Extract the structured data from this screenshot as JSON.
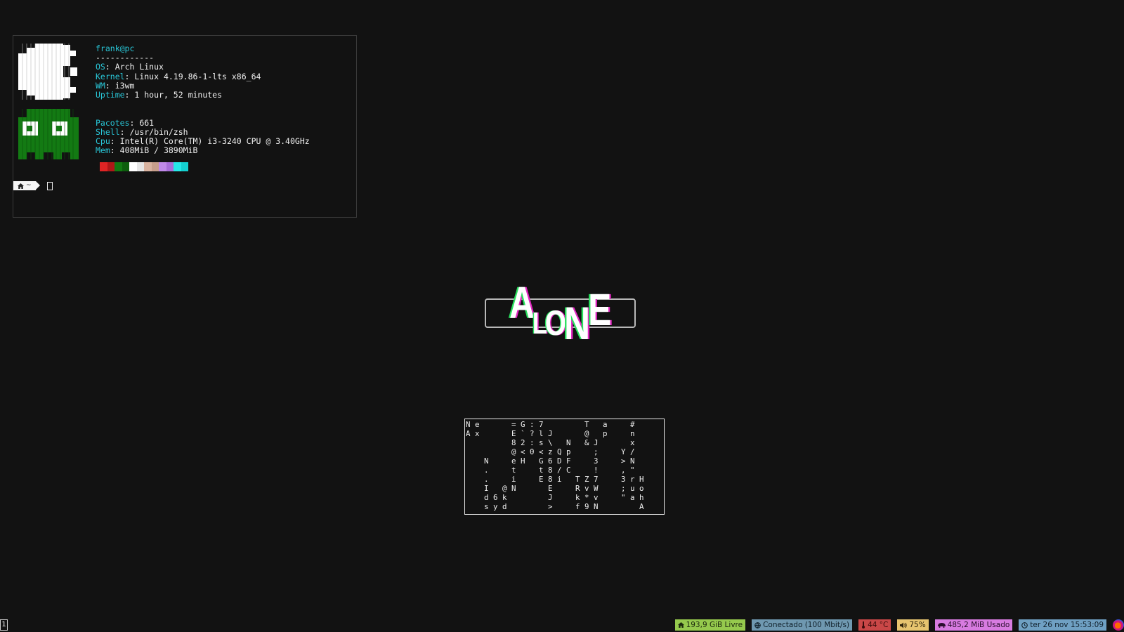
{
  "terminal": {
    "user_host": "frank@pc",
    "separator": "------------",
    "info": [
      {
        "key": "OS",
        "value": "Arch Linux"
      },
      {
        "key": "Kernel",
        "value": "Linux 4.19.86-1-lts x86_64"
      },
      {
        "key": "WM",
        "value": "i3wm"
      },
      {
        "key": "Uptime",
        "value": "1 hour, 52 minutes"
      }
    ],
    "info2": [
      {
        "key": "Pacotes",
        "value": "661"
      },
      {
        "key": "Shell",
        "value": "/usr/bin/zsh"
      },
      {
        "key": "Cpu",
        "value": "Intel(R) Core(TM) i3-3240 CPU @ 3.40GHz"
      },
      {
        "key": "Mem",
        "value": "408MiB / 3890MiB"
      }
    ],
    "palette": [
      "#e02424",
      "#b01818",
      "#127a12",
      "#0d5e0d",
      "#ffffff",
      "#e6e6e6",
      "#d9b3a0",
      "#c89f8c",
      "#c08ae8",
      "#a86fd8",
      "#26e8e8",
      "#14d0d0"
    ],
    "prompt_dir": "~",
    "prompt_icon": "home-icon"
  },
  "logo": {
    "letters": [
      "A",
      "L",
      "O",
      "N",
      "E"
    ],
    "accent_left": "#29e05e",
    "accent_right": "#e026c0"
  },
  "matrix": {
    "lines": [
      "N e       = G : 7         T   a     #    ",
      "A x       E ` ? l J       @   p     n    ",
      "          8 2 : s \\   N   & J       x    ",
      "          @ < 0 < z Q p     ;     Y /    ",
      "    N     e H   G 6 D F     3     > N    ",
      "    .     t     t 8 / C     !     , \"    ",
      "    .     i     E 8 i   T Z 7     3 r H  ",
      "    I   @ N       E     R v W     ; u o  ",
      "    d 6 k         J     k * v     \" a h  ",
      "    s y d         >     f 9 N         A  "
    ]
  },
  "bar": {
    "workspace": "1",
    "disk": {
      "icon": "home-icon",
      "text": "193,9 GiB Livre"
    },
    "network": {
      "icon": "globe-icon",
      "text": "Conectado (100 Mbit/s)"
    },
    "temperature": {
      "icon": "thermometer-icon",
      "text": "44 °C"
    },
    "volume": {
      "icon": "speaker-icon",
      "text": "75%"
    },
    "memory": {
      "icon": "memory-icon",
      "text": "485,2 MiB Usado"
    },
    "date": {
      "icon": "clock-icon",
      "text": "ter 26 nov 15:53:09"
    },
    "tray_icon": "firefox-icon"
  }
}
